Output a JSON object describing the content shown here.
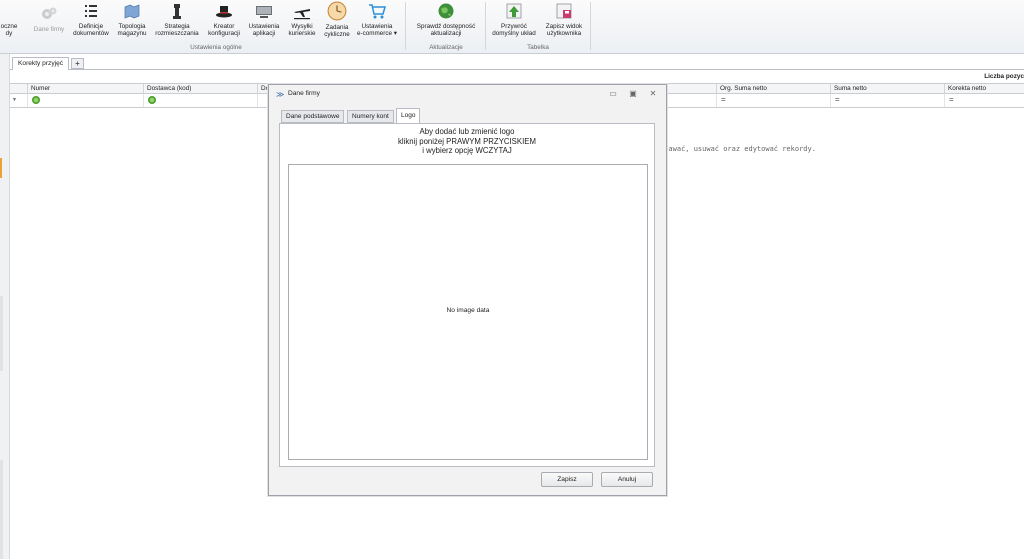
{
  "ribbon": {
    "buttons": [
      {
        "label": "ocz\nne\ndy",
        "l1": "oczne",
        "l2": "dy",
        "icon": "partial-icon"
      },
      {
        "l1": "Dane firmy",
        "l2": "",
        "icon": "gears-icon",
        "disabled": true
      },
      {
        "l1": "Definicje",
        "l2": "dokumentów",
        "icon": "list-icon"
      },
      {
        "l1": "Topologia",
        "l2": "magazynu",
        "icon": "map-icon"
      },
      {
        "l1": "Strategia",
        "l2": "rozmieszczania",
        "icon": "chess-icon"
      },
      {
        "l1": "Kreator",
        "l2": "konfiguracji",
        "icon": "magic-hat-icon"
      },
      {
        "l1": "Ustawienia",
        "l2": "aplikacji",
        "icon": "monitor-icon"
      },
      {
        "l1": "Wysyłki",
        "l2": "kurierskie",
        "icon": "airplane-icon"
      },
      {
        "l1": "Zadania",
        "l2": "cykliczne",
        "icon": "clock-icon"
      },
      {
        "l1": "Ustawienia",
        "l2": "e-commerce ▾",
        "icon": "cart-icon"
      },
      {
        "l1": "Sprawdź dostępność",
        "l2": "aktualizacji",
        "icon": "globe-icon"
      },
      {
        "l1": "Przywróć",
        "l2": "domyślny układ",
        "icon": "restore-layout-icon"
      },
      {
        "l1": "Zapisz widok",
        "l2": "użytkownika",
        "icon": "save-view-icon"
      }
    ],
    "groups": {
      "general": "Ustawienia ogólne",
      "updates": "Aktualizacje",
      "table": "Tabelka"
    },
    "colors": {
      "accent": "#3a7fd5",
      "rail_accent": "#e8a33a"
    }
  },
  "tabs": {
    "active": "Korekty przyjęć",
    "add": "+"
  },
  "grid": {
    "count_label": "Liczba pozyc",
    "columns": [
      "Numer",
      "Dostawca (kod)",
      "Do",
      "Org. Suma netto",
      "Suma netto",
      "Korekta netto"
    ],
    "filter_eq": "="
  },
  "empty_hint": "odawać, usuwać oraz edytować rekordy.",
  "dialog": {
    "title": "Dane firmy",
    "tabs": [
      "Dane podstawowe",
      "Numery kont",
      "Logo"
    ],
    "active_tab": "Logo",
    "instruction_1": "Aby dodać lub zmienić logo",
    "instruction_2": "kliknij poniżej PRAWYM PRZYCISKIEM",
    "instruction_3": "i wybierz opcję WCZYTAJ",
    "no_image": "No image data",
    "save_label": "Zapisz",
    "cancel_label": "Anuluj"
  }
}
